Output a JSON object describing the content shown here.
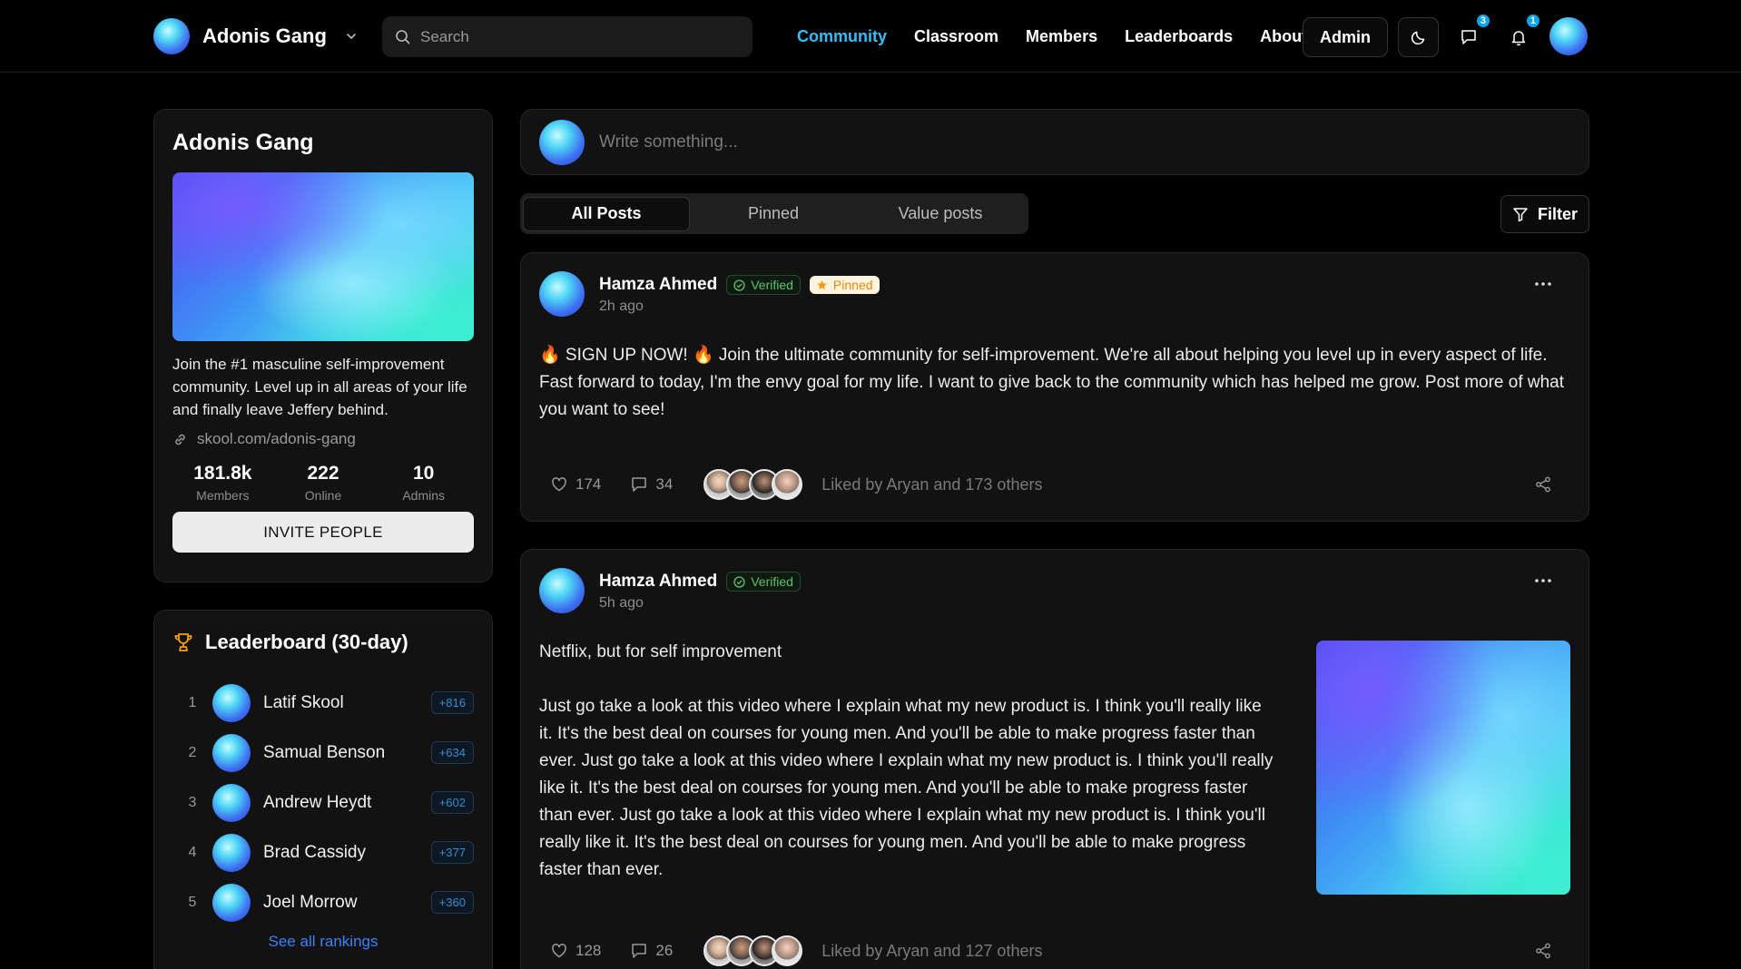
{
  "navbar": {
    "brand": "Adonis Gang",
    "search_placeholder": "Search",
    "links": [
      "Community",
      "Classroom",
      "Members",
      "Leaderboards",
      "About"
    ],
    "active_link": "Community",
    "admin_label": "Admin",
    "chat_badge": "3",
    "notif_badge": "1"
  },
  "about": {
    "title": "Adonis Gang",
    "description": "Join the #1 masculine self-improvement community. Level up in all areas of your life and finally leave Jeffery behind.",
    "link": "skool.com/adonis-gang",
    "stats": [
      {
        "value": "181.8k",
        "label": "Members"
      },
      {
        "value": "222",
        "label": "Online"
      },
      {
        "value": "10",
        "label": "Admins"
      }
    ],
    "invite_label": "INVITE PEOPLE"
  },
  "leaderboard": {
    "title": "Leaderboard (30-day)",
    "rows": [
      {
        "rank": "1",
        "name": "Latif Skool",
        "points": "+816"
      },
      {
        "rank": "2",
        "name": "Samual Benson",
        "points": "+634"
      },
      {
        "rank": "3",
        "name": "Andrew Heydt",
        "points": "+602"
      },
      {
        "rank": "4",
        "name": "Brad Cassidy",
        "points": "+377"
      },
      {
        "rank": "5",
        "name": "Joel Morrow",
        "points": "+360"
      }
    ],
    "see_all": "See all rankings"
  },
  "composer": {
    "placeholder": "Write something..."
  },
  "tabs": [
    "All Posts",
    "Pinned",
    "Value posts"
  ],
  "active_tab": "All Posts",
  "filter_label": "Filter",
  "posts": [
    {
      "author": "Hamza Ahmed",
      "verified": "Verified",
      "pinned": "Pinned",
      "time": "2h ago",
      "body": "🔥 SIGN UP NOW! 🔥 Join the ultimate community for self-improvement. We're all about helping you level up in every aspect of life. Fast forward to today, I'm the envy goal for my life. I want to give back to the community which has helped me grow. Post more of what you want to see!",
      "likes": "174",
      "comments": "34",
      "liked_by": "Liked by Aryan and 173 others"
    },
    {
      "author": "Hamza Ahmed",
      "verified": "Verified",
      "time": "5h ago",
      "title": "Netflix, but for self improvement",
      "body": "Just go take a look at this video where I explain what my new product is. I think you'll really like it. It's the best deal on courses for young men. And you'll be able to make progress faster than ever. Just go take a look at this video where I explain what my new product is. I think you'll really like it. It's the best deal on courses for young men. And you'll be able to make progress faster than ever. Just go take a look at this video where I explain what my new product is. I think you'll really like it. It's the best deal on courses for young men. And you'll be able to make progress faster than ever.",
      "likes": "128",
      "comments": "26",
      "liked_by": "Liked by Aryan and 127 others"
    }
  ],
  "colors": {
    "accent": "#38bdf8",
    "verified": "#5fc26b",
    "pinned": "#f59e0b",
    "background": "#000000",
    "card": "#121212"
  }
}
